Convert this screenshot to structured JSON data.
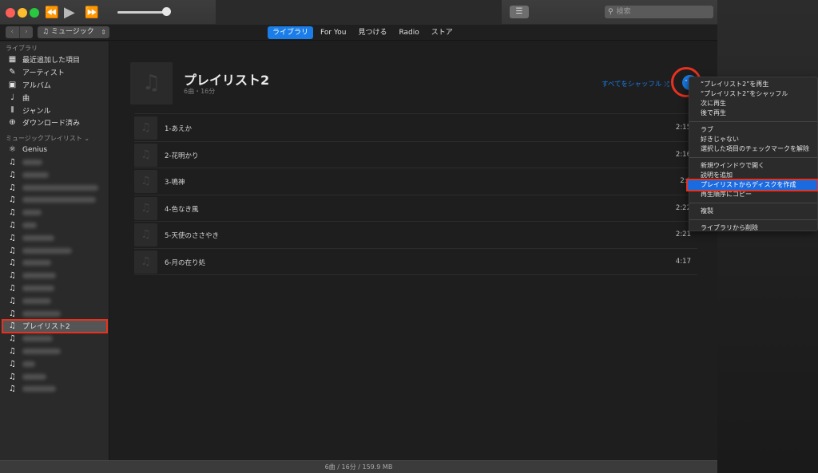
{
  "window": {
    "search_placeholder": "検索"
  },
  "transport": {
    "prev_icon": "⏪",
    "play_icon": "▶",
    "next_icon": "⏩",
    "volume_level": 0.9
  },
  "navbar": {
    "back_icon": "‹",
    "forward_icon": "›",
    "media_type": "ミュージック",
    "tabs": [
      {
        "label": "ライブラリ",
        "active": true
      },
      {
        "label": "For You",
        "active": false
      },
      {
        "label": "見つける",
        "active": false
      },
      {
        "label": "Radio",
        "active": false
      },
      {
        "label": "ストア",
        "active": false
      }
    ]
  },
  "sidebar": {
    "library_header": "ライブラリ",
    "library_items": [
      {
        "label": "最近追加した項目",
        "icon": "▦"
      },
      {
        "label": "アーティスト",
        "icon": "🎤"
      },
      {
        "label": "アルバム",
        "icon": "▣"
      },
      {
        "label": "曲",
        "icon": "♩"
      },
      {
        "label": "ジャンル",
        "icon": "⫴"
      },
      {
        "label": "ダウンロード済み",
        "icon": "⊕"
      }
    ],
    "playlists_header": "ミュージックプレイリスト ⌄",
    "genius_label": "Genius",
    "selected_playlist": "プレイリスト2"
  },
  "playlist": {
    "title": "プレイリスト2",
    "subtitle": "6曲・16分",
    "shuffle_label": "すべてをシャッフル ⤮",
    "more_label": "･･･",
    "tracks": [
      {
        "name": "1-あえか",
        "time": "2:15"
      },
      {
        "name": "2-花明かり",
        "time": "2:16"
      },
      {
        "name": "3-鳴神",
        "time": "2:1"
      },
      {
        "name": "4-色なき風",
        "time": "2:22"
      },
      {
        "name": "5-天使のささやき",
        "time": "2:21"
      },
      {
        "name": "6-月の在り処",
        "time": "4:17"
      }
    ]
  },
  "context_menu": {
    "groups": [
      [
        "“プレイリスト2”を再生",
        "“プレイリスト2”をシャッフル",
        "次に再生",
        "後で再生"
      ],
      [
        "ラブ",
        "好きじゃない",
        "選択した項目のチェックマークを解除"
      ],
      [
        "新規ウインドウで開く",
        "説明を追加",
        "プレイリストからディスクを作成",
        "再生順序にコピー"
      ],
      [
        "複製"
      ],
      [
        "ライブラリから削除"
      ]
    ],
    "highlighted": "プレイリストからディスクを作成"
  },
  "status": {
    "summary": "6曲 / 16分 / 159.9 MB"
  },
  "colors": {
    "accent": "#1a7de8",
    "annotation_red": "#e8321f"
  }
}
